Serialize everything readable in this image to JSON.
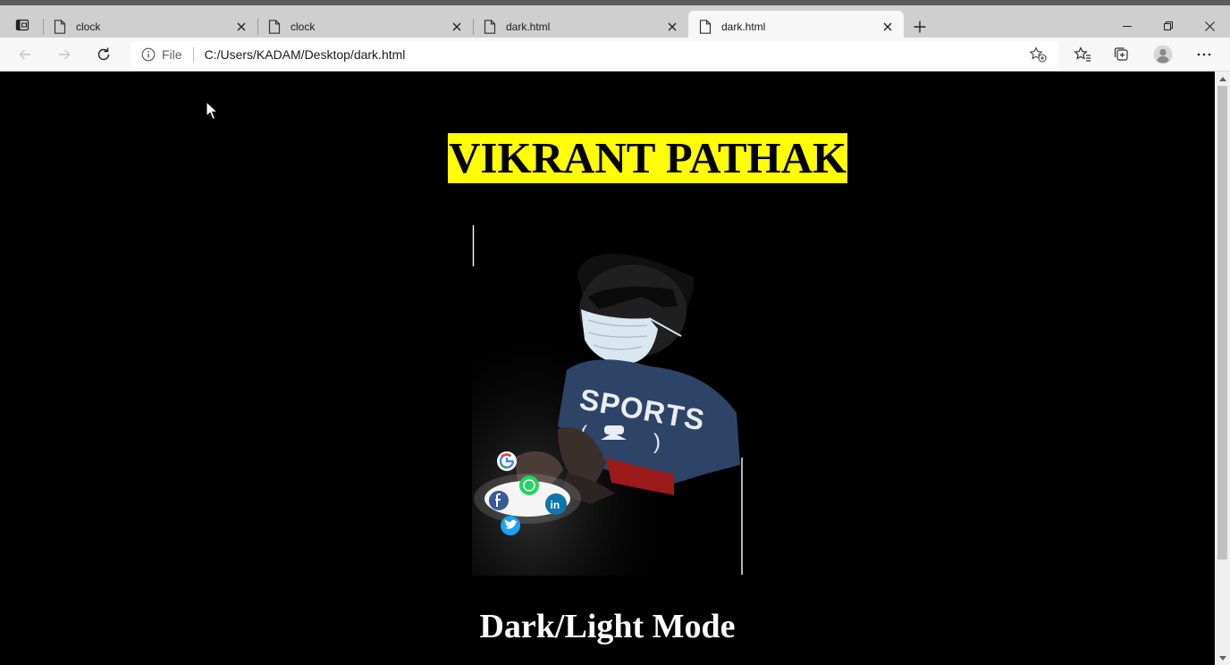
{
  "browser": {
    "tabs": [
      {
        "title": "clock",
        "active": false
      },
      {
        "title": "clock",
        "active": false
      },
      {
        "title": "dark.html",
        "active": false
      },
      {
        "title": "dark.html",
        "active": true
      }
    ],
    "address": {
      "scheme_label": "File",
      "url": "C:/Users/KADAM/Desktop/dark.html"
    },
    "icons": [
      "tab-actions-icon",
      "page-icon",
      "close-icon",
      "new-tab-icon",
      "minimize-icon",
      "restore-icon",
      "window-close-icon",
      "back-icon",
      "forward-icon",
      "refresh-icon",
      "info-icon",
      "add-favorite-icon",
      "favorites-icon",
      "collections-icon",
      "profile-icon",
      "more-icon"
    ]
  },
  "page": {
    "name_heading": "VIKRANT PATHAK",
    "photo_shirt_text": "SPORTS",
    "mode_heading": "Dark/Light Mode",
    "social_icons": [
      "google-icon",
      "whatsapp-icon",
      "facebook-icon",
      "linkedin-icon",
      "twitter-icon"
    ]
  },
  "colors": {
    "page_background": "#000000",
    "name_highlight": "#ffff00",
    "name_text": "#000000",
    "mode_text": "#ffffff",
    "shirt": "#2d4467"
  }
}
